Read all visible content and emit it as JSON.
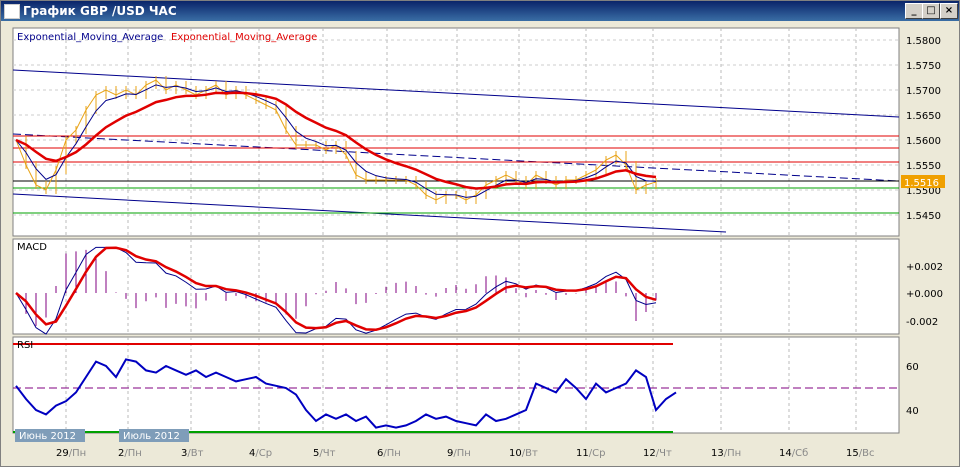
{
  "window": {
    "title": "График GBP /USD  ЧАС",
    "buttons": [
      "_",
      "□",
      "×"
    ]
  },
  "chart_data": {
    "type": "line",
    "legend": [
      "Exponential_Moving_Average",
      "Exponential_Moving_Average"
    ],
    "price_ticks": [
      "1.5800",
      "1.5750",
      "1.5700",
      "1.5650",
      "1.5600",
      "1.5550",
      "1.5500",
      "1.5450"
    ],
    "current_price": "1.5516",
    "price": [
      1.56,
      1.555,
      1.551,
      1.55,
      1.554,
      1.56,
      1.562,
      1.566,
      1.569,
      1.57,
      1.569,
      1.57,
      1.569,
      1.571,
      1.572,
      1.57,
      1.571,
      1.57,
      1.569,
      1.57,
      1.571,
      1.569,
      1.57,
      1.569,
      1.568,
      1.567,
      1.566,
      1.562,
      1.559,
      1.559,
      1.559,
      1.558,
      1.559,
      1.557,
      1.553,
      1.552,
      1.552,
      1.552,
      1.552,
      1.552,
      1.551,
      1.549,
      1.548,
      1.549,
      1.549,
      1.548,
      1.549,
      1.551,
      1.552,
      1.553,
      1.552,
      1.551,
      1.553,
      1.552,
      1.551,
      1.552,
      1.552,
      1.553,
      1.554,
      1.556,
      1.557,
      1.555,
      1.55,
      1.551,
      1.5516
    ],
    "horizontal_levels": {
      "red": [
        1.5608,
        1.5584,
        1.5556
      ],
      "black": [
        1.5518
      ],
      "green": [
        1.5504,
        1.5454
      ]
    },
    "macd": {
      "label": "MACD",
      "ticks": [
        "+0.002",
        "+0.000",
        "-0.002"
      ]
    },
    "rsi": {
      "label": "RSI",
      "ticks": [
        "60",
        "40"
      ],
      "upper": 70,
      "lower": 30,
      "mid": 50,
      "values": [
        51,
        45,
        40,
        38,
        42,
        44,
        48,
        55,
        62,
        60,
        55,
        63,
        62,
        58,
        57,
        60,
        58,
        56,
        58,
        55,
        57,
        55,
        53,
        54,
        55,
        52,
        51,
        50,
        47,
        40,
        35,
        38,
        36,
        38,
        35,
        37,
        32,
        33,
        32,
        33,
        35,
        38,
        36,
        37,
        35,
        34,
        33,
        38,
        35,
        36,
        38,
        40,
        52,
        50,
        48,
        54,
        50,
        45,
        52,
        48,
        50,
        52,
        58,
        55,
        40,
        45,
        48
      ]
    },
    "x_labels": [
      {
        "d": "29",
        "w": "Пн"
      },
      {
        "d": "2",
        "w": "Пн"
      },
      {
        "d": "3",
        "w": "Вт"
      },
      {
        "d": "4",
        "w": "Ср"
      },
      {
        "d": "5",
        "w": "Чт"
      },
      {
        "d": "6",
        "w": "Пн"
      },
      {
        "d": "9",
        "w": "Пн"
      },
      {
        "d": "10",
        "w": "Вт"
      },
      {
        "d": "11",
        "w": "Ср"
      },
      {
        "d": "12",
        "w": "Чт"
      },
      {
        "d": "13",
        "w": "Пн"
      },
      {
        "d": "14",
        "w": "Сб"
      },
      {
        "d": "15",
        "w": "Вс"
      }
    ],
    "month_labels": [
      "Июнь 2012",
      "Июль 2012"
    ]
  },
  "colors": {
    "price": "#e8a317",
    "ema_fast": "#00008b",
    "ema_slow": "#e00000",
    "red": "#e00000",
    "green": "#00a000",
    "rsi": "#0000c0"
  }
}
